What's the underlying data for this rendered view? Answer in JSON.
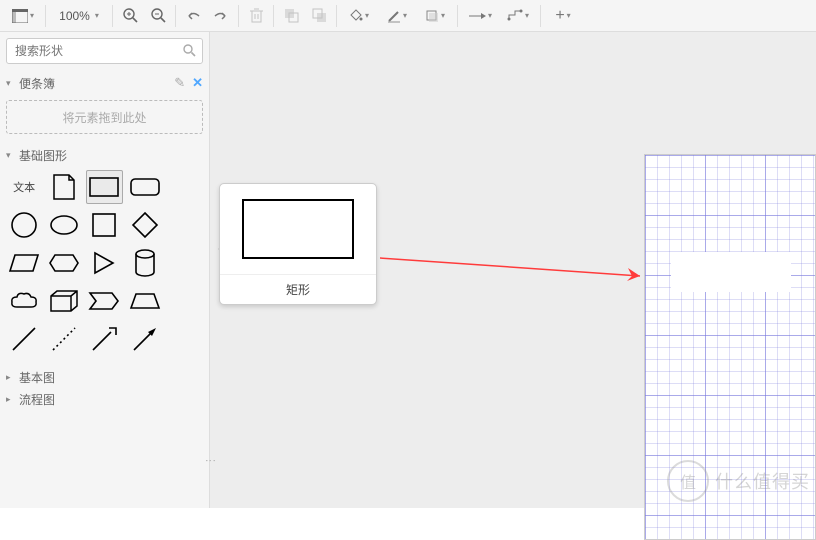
{
  "toolbar": {
    "zoom": "100%"
  },
  "search": {
    "placeholder": "搜索形状"
  },
  "panels": {
    "notes": {
      "title": "便条簿",
      "dropzone": "将元素拖到此处"
    },
    "basic": {
      "title": "基础图形",
      "shapes_row1": {
        "text_label": "文本"
      }
    },
    "basic2": {
      "title": "基本图"
    },
    "flow": {
      "title": "流程图"
    }
  },
  "tooltip": {
    "label": "矩形"
  },
  "watermark": {
    "symbol": "值",
    "text": "什么值得买"
  }
}
